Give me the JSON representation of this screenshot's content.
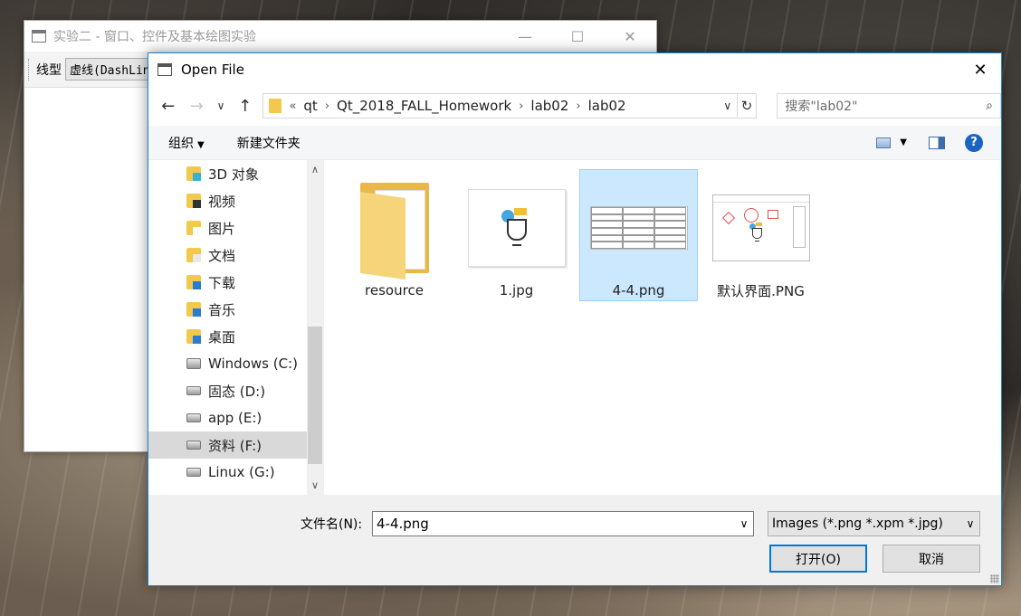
{
  "back_window": {
    "title": "实验二 - 窗口、控件及基本绘图实验",
    "minimize": "—",
    "maximize": "☐",
    "close": "✕",
    "toolbar": {
      "line_type_label": "线型",
      "line_type_value": "虚线(DashLine)"
    }
  },
  "dialog": {
    "title": "Open File",
    "close": "✕",
    "nav": {
      "back": "←",
      "forward": "→",
      "recent": "∨",
      "up": "↑"
    },
    "address": {
      "overflow": "«",
      "crumbs": [
        "qt",
        "Qt_2018_FALL_Homework",
        "lab02",
        "lab02"
      ],
      "separator": "›",
      "dropdown": "∨",
      "refresh": "↻"
    },
    "search": {
      "placeholder": "搜索\"lab02\"",
      "icon": "⌕"
    },
    "command_bar": {
      "organize": "组织",
      "organize_caret": "▼",
      "new_folder": "新建文件夹",
      "view_caret": "▼",
      "help": "?"
    },
    "nav_pane": {
      "items": [
        {
          "label": "3D 对象",
          "icon": "3d-objects-icon"
        },
        {
          "label": "视频",
          "icon": "videos-icon"
        },
        {
          "label": "图片",
          "icon": "pictures-icon"
        },
        {
          "label": "文档",
          "icon": "documents-icon"
        },
        {
          "label": "下载",
          "icon": "downloads-icon"
        },
        {
          "label": "音乐",
          "icon": "music-icon"
        },
        {
          "label": "桌面",
          "icon": "desktop-icon"
        },
        {
          "label": "Windows (C:)",
          "icon": "windows-drive-icon"
        },
        {
          "label": "固态 (D:)",
          "icon": "drive-icon"
        },
        {
          "label": "app (E:)",
          "icon": "drive-icon"
        },
        {
          "label": "资料 (F:)",
          "icon": "drive-icon",
          "selected": true
        },
        {
          "label": "Linux (G:)",
          "icon": "drive-icon"
        }
      ],
      "scroll_up": "∧",
      "scroll_down": "∨"
    },
    "files": [
      {
        "name": "resource",
        "type": "folder"
      },
      {
        "name": "1.jpg",
        "type": "image"
      },
      {
        "name": "4-4.png",
        "type": "table-image",
        "selected": true
      },
      {
        "name": "默认界面.PNG",
        "type": "ui-image"
      }
    ],
    "footer": {
      "filename_label": "文件名(N):",
      "filename_value": "4-4.png",
      "filename_dropdown": "∨",
      "filter_value": "Images (*.png *.xpm *.jpg)",
      "filter_dropdown": "∨",
      "open_button": "打开(O)",
      "cancel_button": "取消"
    }
  }
}
